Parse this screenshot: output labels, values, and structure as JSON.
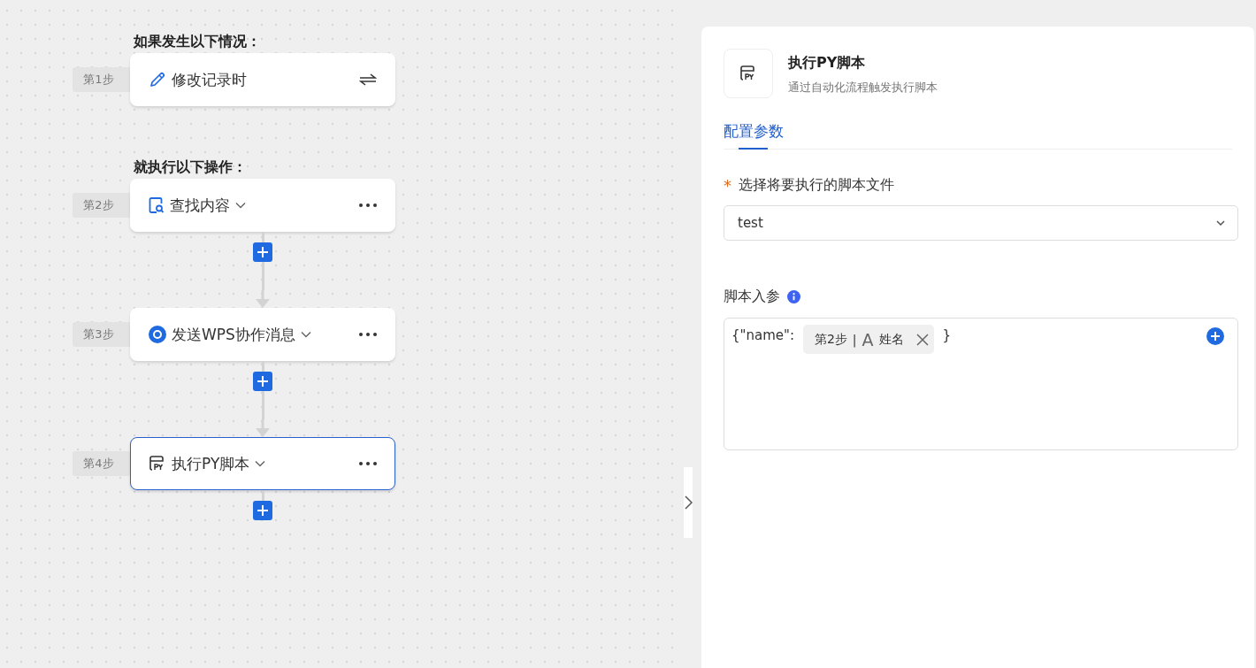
{
  "flow": {
    "sections": [
      {
        "title": "如果发生以下情况：",
        "steps": [
          {
            "step": "第1步",
            "label": "修改记录时",
            "kind": "trigger",
            "selected": false
          }
        ]
      },
      {
        "title": "就执行以下操作：",
        "steps": [
          {
            "step": "第2步",
            "label": "查找内容",
            "kind": "action",
            "selected": false
          },
          {
            "step": "第3步",
            "label": "发送WPS协作消息",
            "kind": "action",
            "selected": false
          },
          {
            "step": "第4步",
            "label": "执行PY脚本",
            "kind": "action",
            "selected": true
          }
        ]
      }
    ]
  },
  "panel": {
    "title": "执行PY脚本",
    "subtitle": "通过自动化流程触发执行脚本",
    "tabs": [
      {
        "label": "配置参数",
        "selected": true
      }
    ],
    "script_field": {
      "label": "选择将要执行的脚本文件",
      "required_mark": "*",
      "value": "test"
    },
    "params_field": {
      "label": "脚本入参",
      "prefix": "{\"name\":",
      "token": {
        "step": "第2步",
        "separator": "|",
        "type_glyph": "A",
        "field": "姓名"
      },
      "suffix": "}"
    }
  }
}
